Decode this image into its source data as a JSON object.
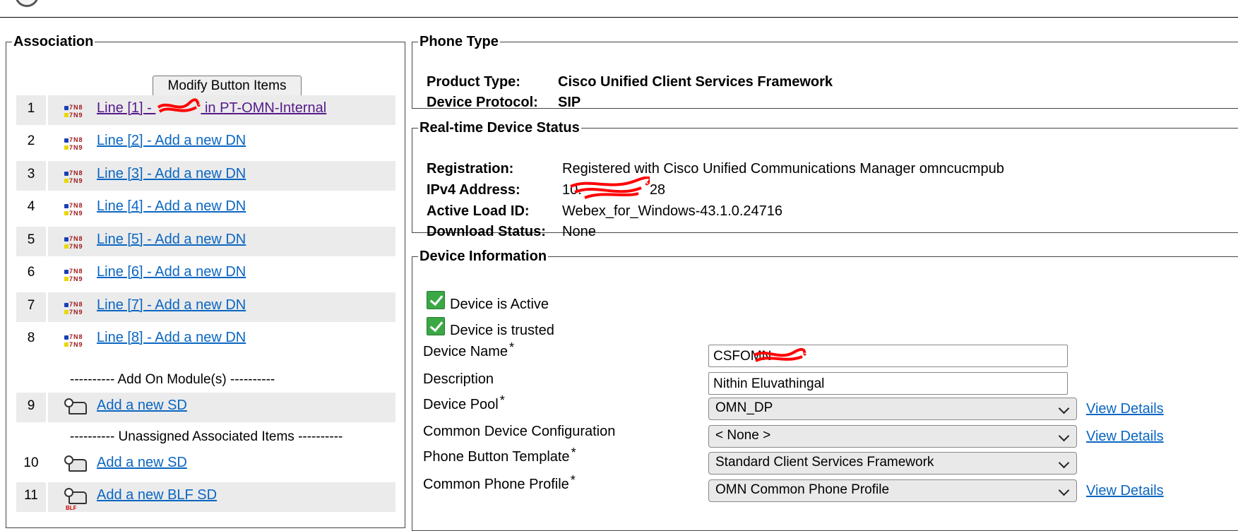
{
  "association": {
    "legend": "Association",
    "modify_button": "Modify Button Items",
    "lines": [
      {
        "num": "1",
        "label": "Line [1] - ",
        "label_suffix": " in PT-OMN-Internal",
        "visited": true
      },
      {
        "num": "2",
        "label": "Line [2] - Add a new DN"
      },
      {
        "num": "3",
        "label": "Line [3] - Add a new DN"
      },
      {
        "num": "4",
        "label": "Line [4] - Add a new DN"
      },
      {
        "num": "5",
        "label": "Line [5] - Add a new DN"
      },
      {
        "num": "6",
        "label": "Line [6] - Add a new DN"
      },
      {
        "num": "7",
        "label": "Line [7] - Add a new DN"
      },
      {
        "num": "8",
        "label": "Line [8] - Add a new DN"
      }
    ],
    "addon_separator": "---------- Add On Module(s) ----------",
    "addon_items": [
      {
        "num": "9",
        "label": "Add a new SD"
      }
    ],
    "unassigned_separator": "---------- Unassigned Associated Items ----------",
    "unassigned_items": [
      {
        "num": "10",
        "label": "Add a new SD"
      },
      {
        "num": "11",
        "label": "Add a new BLF SD",
        "badge": "BLF"
      }
    ],
    "icons": {
      "line": "line-icon",
      "speed_dial": "speed-dial-icon"
    }
  },
  "phone_type": {
    "legend": "Phone Type",
    "product_type_label": "Product Type:",
    "product_type_value": "Cisco Unified Client Services Framework",
    "device_protocol_label": "Device Protocol:",
    "device_protocol_value": "SIP"
  },
  "realtime_status": {
    "legend": "Real-time Device Status",
    "registration_label": "Registration:",
    "registration_value": "Registered with Cisco Unified Communications Manager omncucmpub",
    "ipv4_label": "IPv4 Address:",
    "ipv4_value": "10.",
    "ipv4_value_tail": "28",
    "active_load_label": "Active Load ID:",
    "active_load_value": "Webex_for_Windows-43.1.0.24716",
    "download_status_label": "Download Status:",
    "download_status_value": "None"
  },
  "device_info": {
    "legend": "Device Information",
    "device_active_label": "Device is Active",
    "device_trusted_label": "Device is trusted",
    "device_name_label": "Device Name",
    "device_name_value": "CSFOMN",
    "description_label": "Description",
    "description_value": "Nithin Eluvathingal",
    "device_pool_label": "Device Pool",
    "device_pool_value": "OMN_DP",
    "common_device_config_label": "Common Device Configuration",
    "common_device_config_value": "< None >",
    "phone_button_template_label": "Phone Button Template",
    "phone_button_template_value": "Standard Client Services Framework",
    "common_phone_profile_label": "Common Phone Profile",
    "common_phone_profile_value": "OMN Common Phone Profile",
    "required_marker": "*",
    "view_details": "View Details"
  },
  "colors": {
    "link": "#0a66c2",
    "visited_link": "#551a8b",
    "row_shade": "#ebebeb",
    "check_green": "#3aa845",
    "redaction": "#ff0000"
  }
}
